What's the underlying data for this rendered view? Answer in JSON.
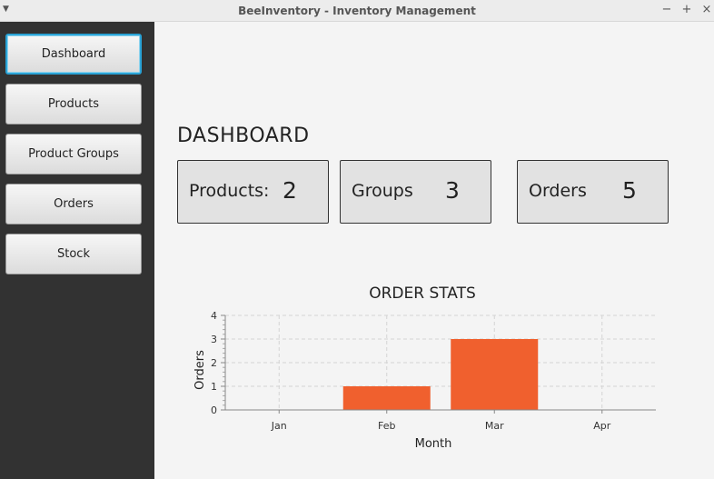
{
  "window": {
    "title": "BeeInventory - Inventory Management",
    "menu_icon": "chevron-down-icon",
    "controls": [
      "−",
      "+",
      "×"
    ]
  },
  "sidebar": {
    "items": [
      {
        "label": "Dashboard",
        "active": true
      },
      {
        "label": "Products",
        "active": false
      },
      {
        "label": "Product Groups",
        "active": false
      },
      {
        "label": "Orders",
        "active": false
      },
      {
        "label": "Stock",
        "active": false
      }
    ]
  },
  "dashboard": {
    "title": "DASHBOARD",
    "stats": [
      {
        "label": "Products:",
        "value": "2"
      },
      {
        "label": "Groups",
        "value": "3"
      },
      {
        "label": "Orders",
        "value": "5"
      }
    ]
  },
  "chart_data": {
    "type": "bar",
    "title": "ORDER STATS",
    "xlabel": "Month",
    "ylabel": "Orders",
    "categories": [
      "Jan",
      "Feb",
      "Mar",
      "Apr"
    ],
    "values": [
      0,
      1,
      3,
      0
    ],
    "ylim": [
      0,
      4
    ],
    "yticks": [
      "0",
      "1",
      "2",
      "3",
      "4"
    ],
    "grid": true,
    "bar_color": "#f0602e"
  },
  "colors": {
    "sidebar_bg": "#323232",
    "active_border": "#2aa3d6",
    "bar": "#f0602e"
  }
}
